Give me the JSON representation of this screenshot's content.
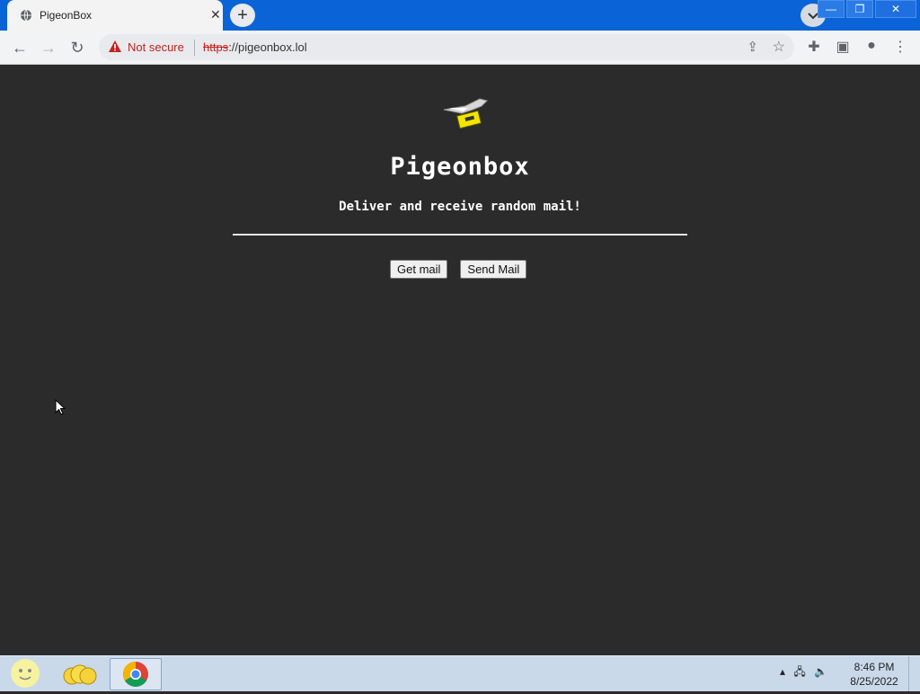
{
  "browser": {
    "tab_title": "PigeonBox",
    "tab_close": "✕",
    "new_tab": "+",
    "window_buttons": {
      "minimize": "—",
      "restore": "❐",
      "close": "✕"
    },
    "security_text": "Not secure",
    "url_scheme": "https",
    "url_rest": "://pigeonbox.lol"
  },
  "page": {
    "title": "Pigeonbox",
    "subtitle": "Deliver and receive random mail!",
    "buttons": {
      "get_mail": "Get mail",
      "send_mail": "Send Mail"
    }
  },
  "taskbar": {
    "time": "8:46 PM",
    "date": "8/25/2022"
  },
  "colors": {
    "page_background": "#2b2b2b",
    "titlebar": "#0a64d8",
    "not_secure": "#c5221f",
    "text": "#ffffff"
  }
}
